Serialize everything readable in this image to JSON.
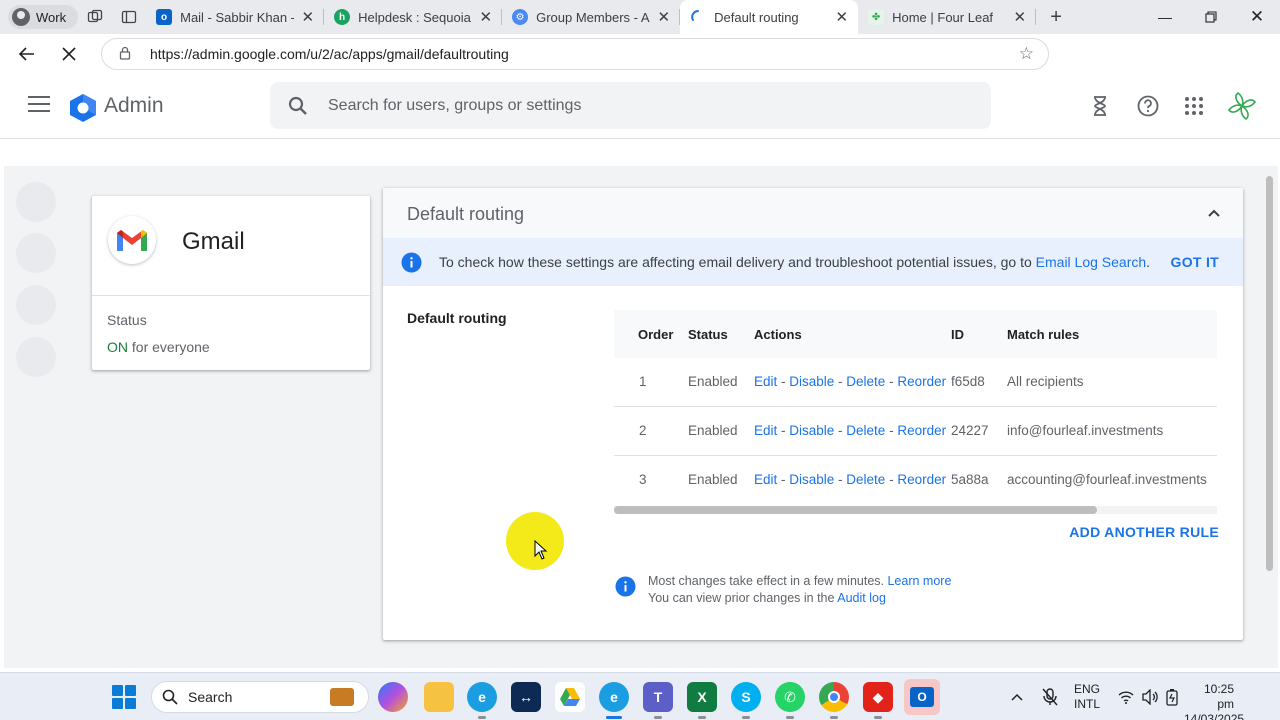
{
  "browser": {
    "profile": "Work",
    "tabs": [
      {
        "title": "Mail - Sabbir Khan - C",
        "favicon": "outlook-icon",
        "color": "#0a64c8"
      },
      {
        "title": "Helpdesk : Sequoia N",
        "favicon": "helpdesk-icon",
        "color": "#1aa260"
      },
      {
        "title": "Group Members - Adr",
        "favicon": "gear-icon",
        "color": "#4a8af4"
      },
      {
        "title": "Default routing",
        "favicon": "loading-icon",
        "color": "#1a73e8",
        "active": true
      },
      {
        "title": "Home | Four Leaf",
        "favicon": "leaf-icon",
        "color": "#34a853"
      }
    ],
    "url": "https://admin.google.com/u/2/ac/apps/gmail/defaultrouting"
  },
  "header": {
    "brand": "Admin",
    "search_placeholder": "Search for users, groups or settings"
  },
  "gmail_card": {
    "title": "Gmail",
    "status_label": "Status",
    "status_value": "ON",
    "status_suffix": " for everyone"
  },
  "panel": {
    "title": "Default routing",
    "banner_text": "To check how these settings are affecting email delivery and troubleshoot potential issues, go to ",
    "banner_link": "Email Log Search",
    "banner_end": ".",
    "got_it": "GOT IT",
    "section_label": "Default routing",
    "columns": [
      "Order",
      "Status",
      "Actions",
      "ID",
      "Match rules"
    ],
    "rows": [
      {
        "order": "1",
        "status": "Enabled",
        "actions": [
          "Edit",
          "Disable",
          "Delete",
          "Reorder"
        ],
        "id": "f65d8",
        "match": "All recipients"
      },
      {
        "order": "2",
        "status": "Enabled",
        "actions": [
          "Edit",
          "Disable",
          "Delete",
          "Reorder"
        ],
        "id": "24227",
        "match": "info@fourleaf.investments"
      },
      {
        "order": "3",
        "status": "Enabled",
        "actions": [
          "Edit",
          "Disable",
          "Delete",
          "Reorder"
        ],
        "id": "5a88a",
        "match": "accounting@fourleaf.investments"
      }
    ],
    "action_sep": " - ",
    "add_rule": "ADD ANOTHER RULE",
    "note1_text": "Most changes take effect in a few minutes. ",
    "note1_link": "Learn more",
    "note2_text": "You can view prior changes in the ",
    "note2_link": "Audit log"
  },
  "taskbar": {
    "search_label": "Search",
    "lang": "ENG",
    "layout": "INTL",
    "time": "10:25 pm",
    "date": "14/03/2025"
  },
  "colors": {
    "accent": "#1a73e8",
    "on_green": "#188038",
    "banner_bg": "#e8f0fe"
  }
}
